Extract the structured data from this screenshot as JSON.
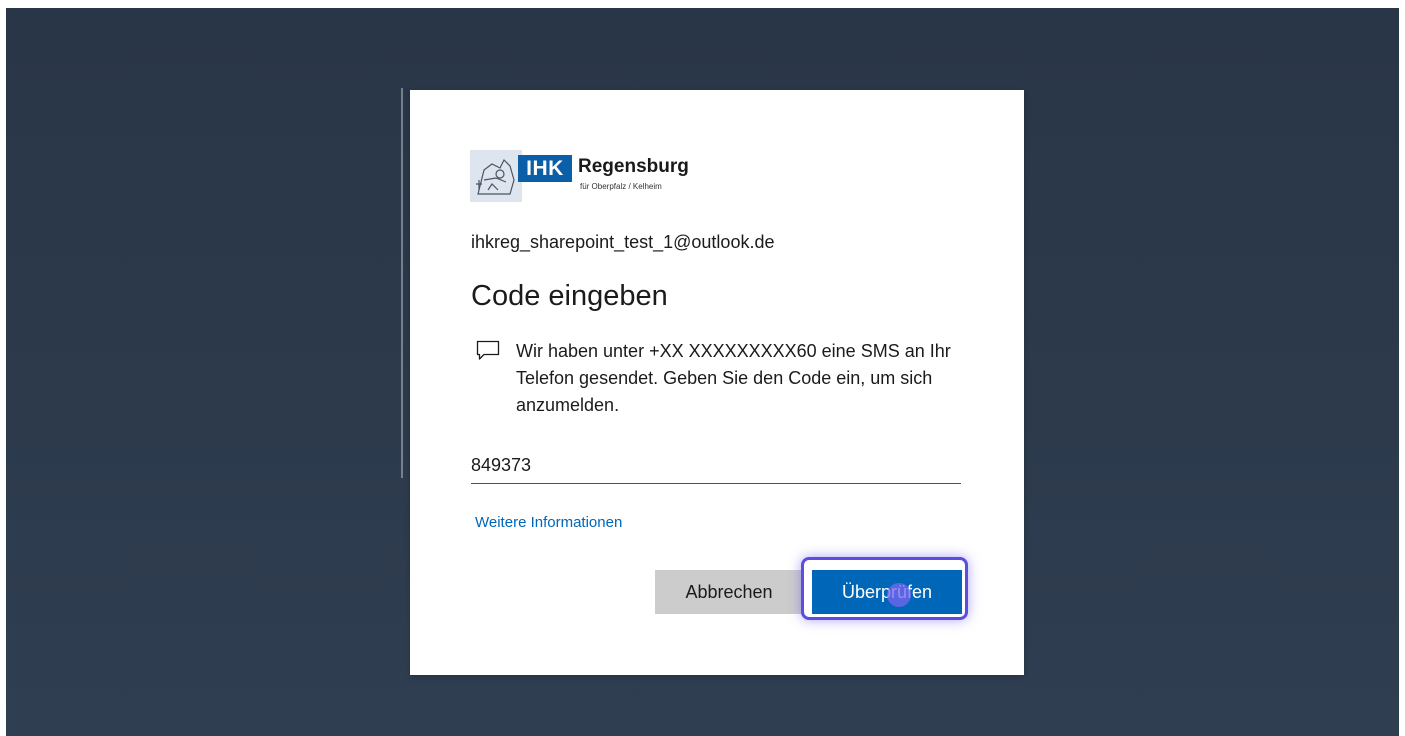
{
  "logo": {
    "badge": "IHK",
    "name": "Regensburg",
    "subtitle": "für Oberpfalz / Kelheim"
  },
  "account": {
    "email": "ihkreg_sharepoint_test_1@outlook.de"
  },
  "dialog": {
    "title": "Code eingeben",
    "message_icon": "chat-bubble-icon",
    "message": "Wir haben unter +XX XXXXXXXXX60 eine SMS an Ihr Telefon gesendet. Geben Sie den Code ein, um sich anzumelden.",
    "code_value": "849373",
    "more_info_link": "Weitere Informationen",
    "cancel_label": "Abbrechen",
    "verify_label": "Überprüfen"
  },
  "colors": {
    "accent": "#0067b8",
    "background": "#2b394b",
    "cancel_button": "#cccccc",
    "highlight": "#5b4de0"
  }
}
